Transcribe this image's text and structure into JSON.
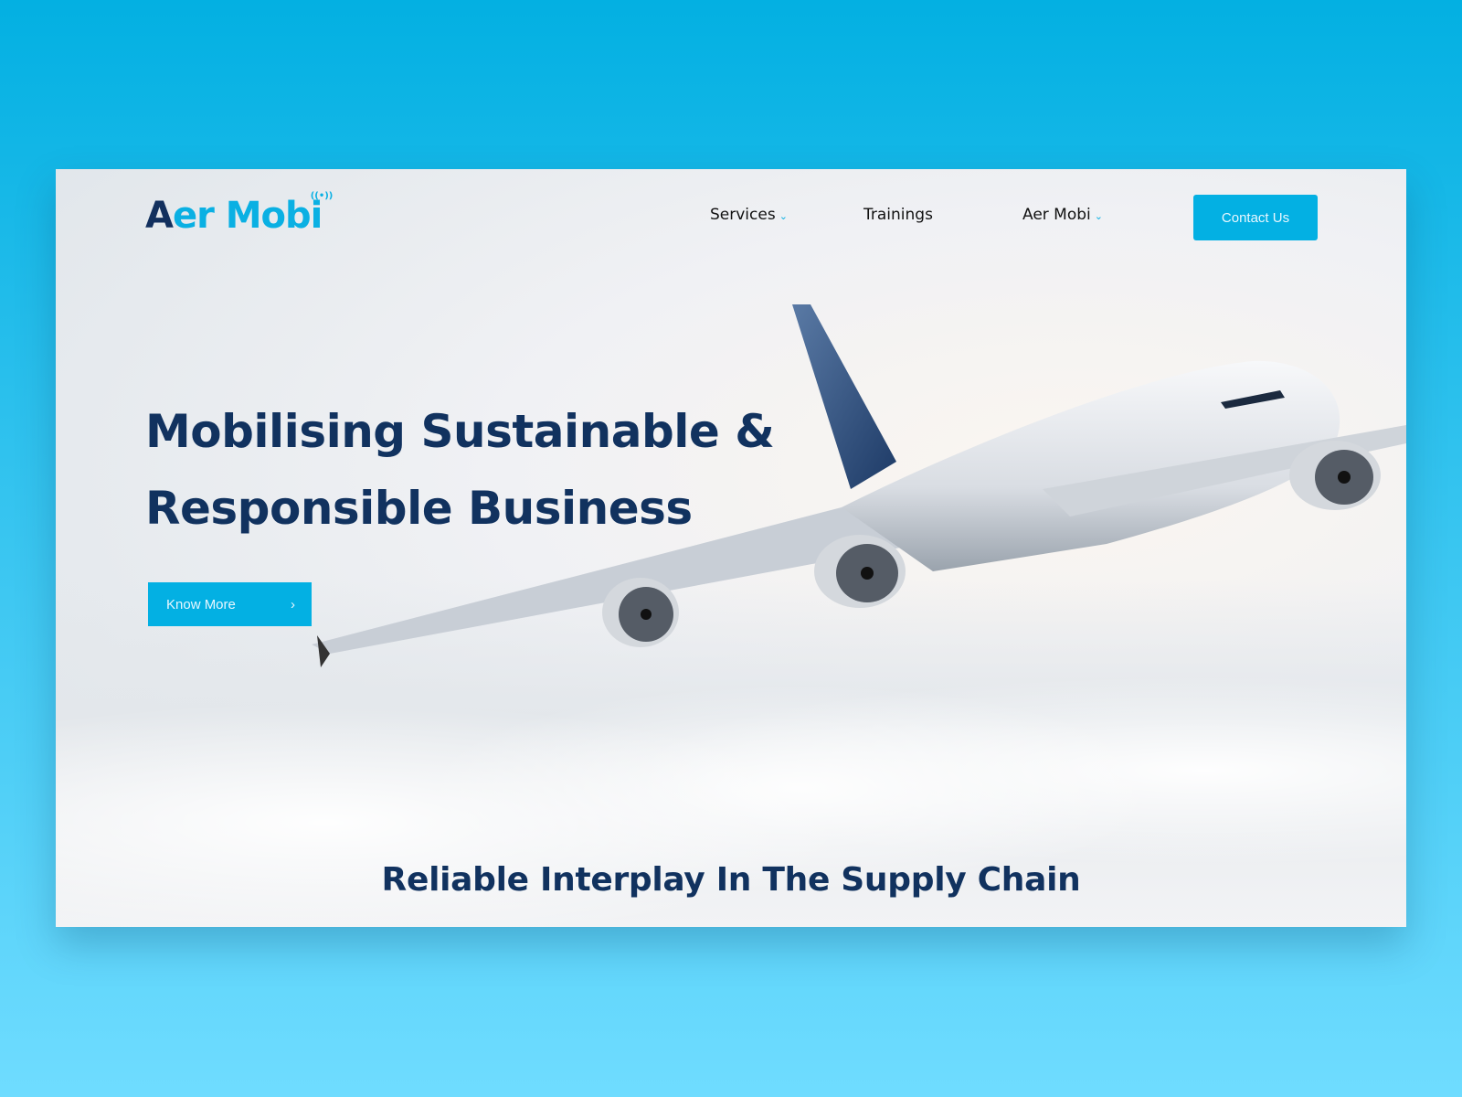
{
  "header": {
    "logo_text": "Aer Mobi",
    "logo_a": "A",
    "logo_rest": "er Mobi",
    "logo_signal": "((•))"
  },
  "nav": {
    "items": [
      {
        "label": "Services",
        "has_dropdown": true
      },
      {
        "label": "Trainings",
        "has_dropdown": false
      },
      {
        "label": "Aer Mobi",
        "has_dropdown": true
      }
    ],
    "chevron": "⌄"
  },
  "contact_label": "Contact Us",
  "hero": {
    "line1": "Mobilising Sustainable &",
    "line2": "Responsible Business",
    "cta_label": "Know More",
    "cta_arrow": "›"
  },
  "subheading": "Reliable Interplay In The Supply Chain",
  "colors": {
    "accent": "#03b0e3",
    "navy": "#11325f",
    "background": "#03b0e2"
  }
}
